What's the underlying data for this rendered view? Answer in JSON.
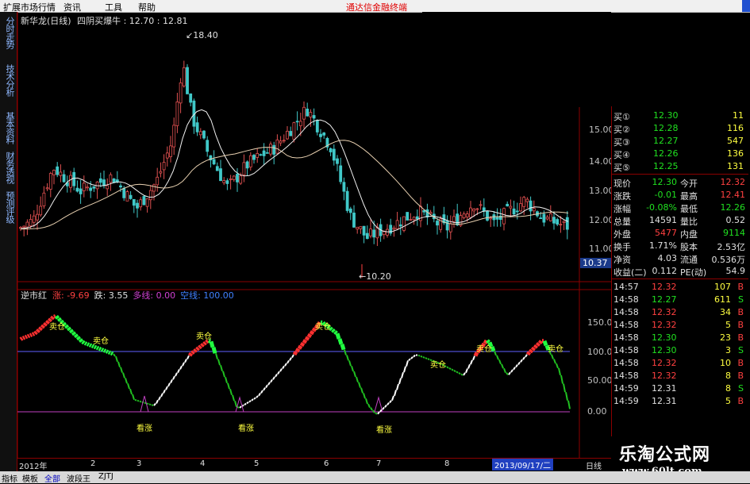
{
  "menu": {
    "items": [
      "扩展市场行情",
      "资讯",
      "工具",
      "帮助"
    ],
    "promo": "通达信金融终端"
  },
  "left_tabs": [
    "分时走势",
    "技术分析",
    "基本资料",
    "财务透视",
    "预测评级"
  ],
  "header": {
    "name": "新华龙(日线)",
    "formula": "四阴买爆牛",
    "values": ": 12.70 : 12.81"
  },
  "price_axis": [
    "15.00",
    "14.00",
    "13.00",
    "12.00",
    "11.00"
  ],
  "current_price_tag": "10.37",
  "annotations": {
    "high": "18.40",
    "low": "10.20"
  },
  "indicator": {
    "name": "逆市红",
    "items": [
      {
        "label": "涨",
        "value": "-9.69",
        "color": "#ff4040"
      },
      {
        "label": "跌",
        "value": "3.55",
        "color": "#e0e0e0"
      },
      {
        "label": "多线",
        "value": "0.00",
        "color": "#d040d0"
      },
      {
        "label": "空线",
        "value": "100.00",
        "color": "#4080ff"
      }
    ],
    "axis": [
      "150.00",
      "100.00",
      "50.00",
      "0.00"
    ],
    "labels_sell": "卖仓",
    "labels_buy": "看涨"
  },
  "quotes": {
    "bids": [
      {
        "label": "买①",
        "price": "12.30",
        "vol": "11"
      },
      {
        "label": "买②",
        "price": "12.28",
        "vol": "116"
      },
      {
        "label": "买③",
        "price": "12.27",
        "vol": "547"
      },
      {
        "label": "买④",
        "price": "12.26",
        "vol": "136"
      },
      {
        "label": "买⑤",
        "price": "12.25",
        "vol": "131"
      }
    ],
    "stats": [
      {
        "l1": "现价",
        "v1": "12.30",
        "c1": "green",
        "l2": "今开",
        "v2": "12.32",
        "c2": "red"
      },
      {
        "l1": "涨跌",
        "v1": "-0.01",
        "c1": "green",
        "l2": "最高",
        "v2": "12.41",
        "c2": "red"
      },
      {
        "l1": "涨幅",
        "v1": "-0.08%",
        "c1": "green",
        "l2": "最低",
        "v2": "12.26",
        "c2": "green"
      },
      {
        "l1": "总量",
        "v1": "14591",
        "c1": "white",
        "l2": "量比",
        "v2": "0.52",
        "c2": "white"
      },
      {
        "l1": "外盘",
        "v1": "5477",
        "c1": "red",
        "l2": "内盘",
        "v2": "9114",
        "c2": "green"
      },
      {
        "l1": "换手",
        "v1": "1.71%",
        "c1": "white",
        "l2": "股本",
        "v2": "2.53亿",
        "c2": "white"
      },
      {
        "l1": "净资",
        "v1": "4.03",
        "c1": "white",
        "l2": "流通",
        "v2": "0.536万",
        "c2": "white"
      },
      {
        "l1": "收益(二)",
        "v1": "0.112",
        "c1": "white",
        "l2": "PE(动)",
        "v2": "54.9",
        "c2": "white"
      }
    ],
    "ticks": [
      {
        "time": "14:57",
        "price": "12.32",
        "pc": "red",
        "vol": "107",
        "side": "B"
      },
      {
        "time": "14:58",
        "price": "12.27",
        "pc": "green",
        "vol": "611",
        "side": "S"
      },
      {
        "time": "14:58",
        "price": "12.32",
        "pc": "red",
        "vol": "34",
        "side": "B"
      },
      {
        "time": "14:58",
        "price": "12.32",
        "pc": "red",
        "vol": "5",
        "side": "B"
      },
      {
        "time": "14:58",
        "price": "12.30",
        "pc": "green",
        "vol": "23",
        "side": "B"
      },
      {
        "time": "14:58",
        "price": "12.30",
        "pc": "green",
        "vol": "3",
        "side": "S"
      },
      {
        "time": "14:58",
        "price": "12.32",
        "pc": "red",
        "vol": "10",
        "side": "B"
      },
      {
        "time": "14:58",
        "price": "12.32",
        "pc": "red",
        "vol": "8",
        "side": "B"
      },
      {
        "time": "14:59",
        "price": "12.31",
        "pc": "white",
        "vol": "8",
        "side": "S"
      },
      {
        "time": "14:59",
        "price": "12.31",
        "pc": "white",
        "vol": "5",
        "side": "B"
      }
    ]
  },
  "date_axis": {
    "labels": [
      "2012年",
      "2",
      "3",
      "4",
      "5",
      "6",
      "7",
      "8"
    ],
    "highlight": "2013/09/17/二",
    "right": "日线"
  },
  "bottom_tabs": [
    "指标",
    "模板",
    "全部",
    "波段王",
    "ZJTJ"
  ],
  "watermark": {
    "title": "乐淘公式网",
    "url": "www.60lt.com"
  }
}
